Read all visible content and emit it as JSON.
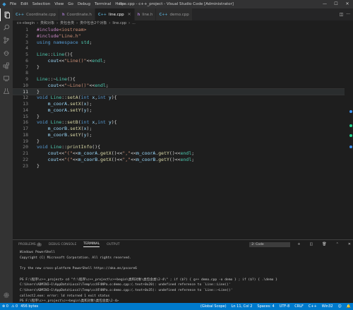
{
  "titlebar": {
    "menu": [
      "File",
      "Edit",
      "Selection",
      "View",
      "Go",
      "Debug",
      "Terminal",
      "Help"
    ],
    "title": "line.cpp - c++_project - Visual Studio Code [Administrator]",
    "minimize": "—",
    "maximize": "☐",
    "close": "✕"
  },
  "tabs": [
    {
      "label": "Coordinate.cpp",
      "icon": "C++",
      "active": false
    },
    {
      "label": "Coordinate.h",
      "icon": "h",
      "active": false
    },
    {
      "label": "line.cpp",
      "icon": "C++",
      "active": true
    },
    {
      "label": "line.h",
      "icon": "h",
      "active": false
    },
    {
      "label": "demo.cpp",
      "icon": "C++",
      "active": false
    }
  ],
  "breadcrumb": [
    "c++begin",
    "类和对象",
    "类包含类",
    "类中包含2个对象",
    "line.cpp",
    "..."
  ],
  "code_lines": [
    "#include<iostream>",
    "#include\"Line.h\"",
    "using namespace std;",
    "",
    "Line::Line(){",
    "    cout<<\"Line()\"<<endl;",
    "}",
    "",
    "Line::~Line(){",
    "    cout<<\"~Line()\"<<endl;",
    "}",
    "void Line::setA(int x,int y){",
    "    m_coorA.setX(x);",
    "    m_coorA.setY(y);",
    "}",
    "void Line::setB(int x,int y){",
    "    m_coorB.setX(x);",
    "    m_coorB.setY(y);",
    "}",
    "void Line::printInfo(){",
    "    cout<<\"(\"<<m_coorA.getX()<<\",\"<<m_coorA.getY()<<endl;",
    "    cout<<\"(\"<<m_coorB.getX()<<\",\"<<m_coorB.getY()<<endl;",
    "}"
  ],
  "current_line": 11,
  "panel": {
    "tabs": [
      "PROBLEMS",
      "DEBUG CONSOLE",
      "TERMINAL",
      "OUTPUT"
    ],
    "problems_count": "1",
    "active_tab": "TERMINAL",
    "terminal_select": "2: Code",
    "terminal_lines": [
      "Windows PowerShell",
      "Copyright (C) Microsoft Corporation. All rights reserved.",
      "",
      "Try the new cross-platform PowerShell https://aka.ms/pscore6",
      "",
      "PS F:\\程序\\c++_project> cd \"f:\\程序\\c++_project\\c++begin\\类和对象\\类包含类\\2-4\\\" ; if ($?) { g++ demo.cpp -o demo } ; if ($?) { .\\demo }",
      "C:\\Users\\ADMINI~1\\AppData\\Local\\Temp\\ccXF4NPa.o:demo.cpp:(.text+0x20): undefined reference to `Line::Line()'",
      "C:\\Users\\ADMINI~1\\AppData\\Local\\Temp\\ccXF4NPa.o:demo.cpp:(.text+0x35): undefined reference to `Line::~Line()'",
      "collect2.exe: error: ld returned 1 exit status",
      "PS F:\\程序\\c++_project\\c++begin\\类和对象\\类包含类\\2-4> "
    ]
  },
  "statusbar": {
    "errors": "⊗ 0",
    "warnings": "⚠ 0",
    "extra": "456 bytes",
    "items": [
      "(Global Scope)",
      "Ln 11, Col 2",
      "Spaces: 4",
      "UTF-8",
      "CRLF",
      "C++",
      "Win32",
      "☺",
      "🔔"
    ]
  },
  "colors": {
    "accent": "#007acc",
    "editor_bg": "#1e1e1e",
    "keyword": "#569cd6",
    "type": "#4ec9b0",
    "string": "#ce9178"
  }
}
